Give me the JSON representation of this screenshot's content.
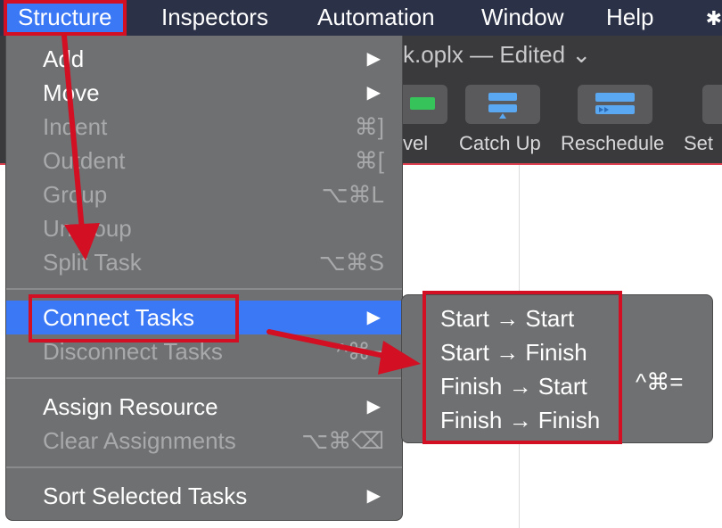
{
  "menubar": {
    "items": [
      "Structure",
      "Inspectors",
      "Automation",
      "Window",
      "Help"
    ],
    "active_index": 0
  },
  "window": {
    "title": "k.oplx — Edited ⌄",
    "toolbar": [
      {
        "label": "vel",
        "icon": "level-icon"
      },
      {
        "label": "Catch Up",
        "icon": "catch-up-icon"
      },
      {
        "label": "Reschedule",
        "icon": "reschedule-icon"
      },
      {
        "label": "Set",
        "icon": "set-icon"
      }
    ]
  },
  "menu": {
    "items": [
      {
        "label": "Add",
        "shortcut": "",
        "submenu": true,
        "enabled": true
      },
      {
        "label": "Move",
        "shortcut": "",
        "submenu": true,
        "enabled": true
      },
      {
        "label": "Indent",
        "shortcut": "⌘]",
        "submenu": false,
        "enabled": false
      },
      {
        "label": "Outdent",
        "shortcut": "⌘[",
        "submenu": false,
        "enabled": false
      },
      {
        "label": "Group",
        "shortcut": "⌥⌘L",
        "submenu": false,
        "enabled": false
      },
      {
        "label": "Ungroup",
        "shortcut": "",
        "submenu": false,
        "enabled": false
      },
      {
        "label": "Split Task",
        "shortcut": "⌥⌘S",
        "submenu": false,
        "enabled": false
      },
      {
        "label": "Connect Tasks",
        "shortcut": "",
        "submenu": true,
        "enabled": true,
        "highlighted": true
      },
      {
        "label": "Disconnect Tasks",
        "shortcut": "^⌘−",
        "submenu": false,
        "enabled": false
      },
      {
        "label": "Assign Resource",
        "shortcut": "",
        "submenu": true,
        "enabled": true
      },
      {
        "label": "Clear Assignments",
        "shortcut": "⌥⌘⌫",
        "submenu": false,
        "enabled": false
      },
      {
        "label": "Sort Selected Tasks",
        "shortcut": "",
        "submenu": true,
        "enabled": true
      }
    ],
    "arrow_glyph": "▶"
  },
  "submenu": {
    "items": [
      "Start → Start",
      "Start → Finish",
      "Finish → Start",
      "Finish → Finish"
    ],
    "shortcut": "^⌘="
  },
  "annotation": {
    "color": "#d20f23"
  }
}
